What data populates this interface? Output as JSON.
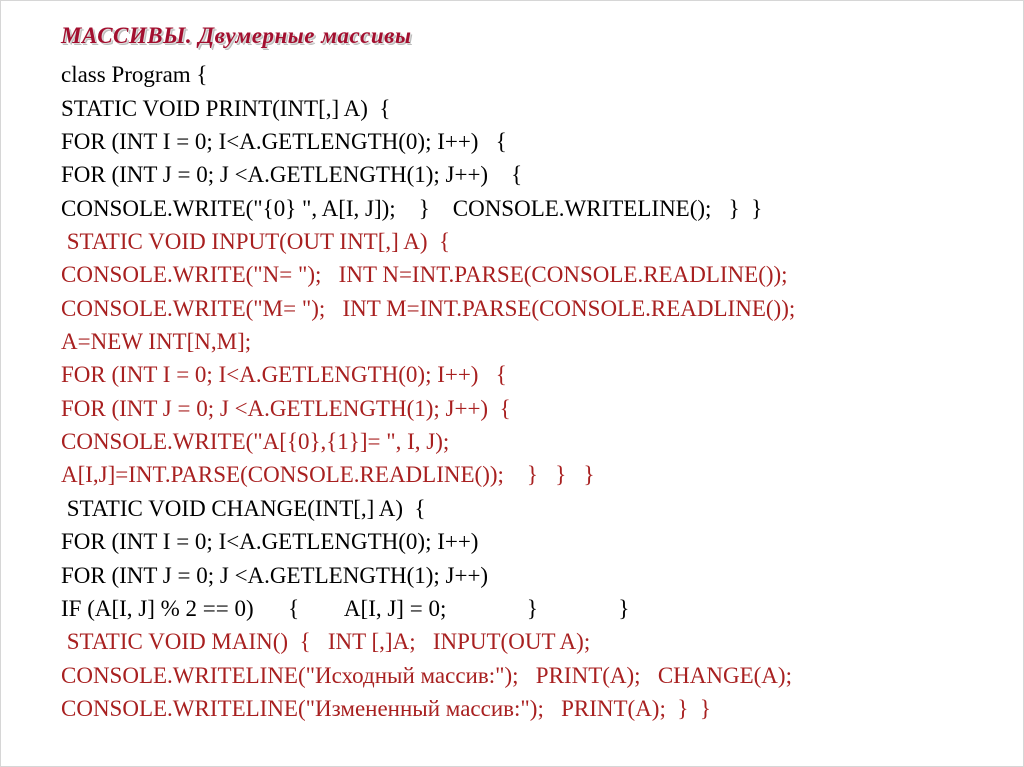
{
  "title": "МАССИВЫ.  Двумерные массивы",
  "lines": [
    {
      "cls": "black",
      "text": "class Program {"
    },
    {
      "cls": "black",
      "text": "STATIC VOID PRINT(INT[,] A)  {"
    },
    {
      "cls": "black",
      "text": "FOR (INT I = 0; I<A.GETLENGTH(0); I++)   {"
    },
    {
      "cls": "black",
      "text": "FOR (INT J = 0; J <A.GETLENGTH(1); J++)    {"
    },
    {
      "cls": "black",
      "text": "CONSOLE.WRITE(\"{0} \", A[I, J]);    }    CONSOLE.WRITELINE();   }  }"
    },
    {
      "cls": "red",
      "text": " STATIC VOID INPUT(OUT INT[,] A)  {"
    },
    {
      "cls": "red",
      "text": "CONSOLE.WRITE(\"N= \");   INT N=INT.PARSE(CONSOLE.READLINE());"
    },
    {
      "cls": "red",
      "text": "CONSOLE.WRITE(\"M= \");   INT M=INT.PARSE(CONSOLE.READLINE());"
    },
    {
      "cls": "red",
      "text": "A=NEW INT[N,M];"
    },
    {
      "cls": "red",
      "text": "FOR (INT I = 0; I<A.GETLENGTH(0); I++)   {"
    },
    {
      "cls": "red",
      "text": "FOR (INT J = 0; J <A.GETLENGTH(1); J++)  {"
    },
    {
      "cls": "red",
      "text": "CONSOLE.WRITE(\"A[{0},{1}]= \", I, J);"
    },
    {
      "cls": "red",
      "text": "A[I,J]=INT.PARSE(CONSOLE.READLINE());    }   }   }"
    },
    {
      "cls": "black",
      "text": " STATIC VOID CHANGE(INT[,] A)  {"
    },
    {
      "cls": "black",
      "text": "FOR (INT I = 0; I<A.GETLENGTH(0); I++)"
    },
    {
      "cls": "black",
      "text": "FOR (INT J = 0; J <A.GETLENGTH(1); J++)"
    },
    {
      "cls": "black",
      "text": "IF (A[I, J] % 2 == 0)      {        A[I, J] = 0;              }              }"
    },
    {
      "cls": "red",
      "text": " STATIC VOID MAIN()  {   INT [,]A;   INPUT(OUT A);"
    },
    {
      "cls": "red",
      "text": "CONSOLE.WRITELINE(\"Исходный массив:\");   PRINT(A);   CHANGE(A);"
    },
    {
      "cls": "red",
      "text": "CONSOLE.WRITELINE(\"Измененный массив:\");   PRINT(A);  }  }"
    }
  ]
}
